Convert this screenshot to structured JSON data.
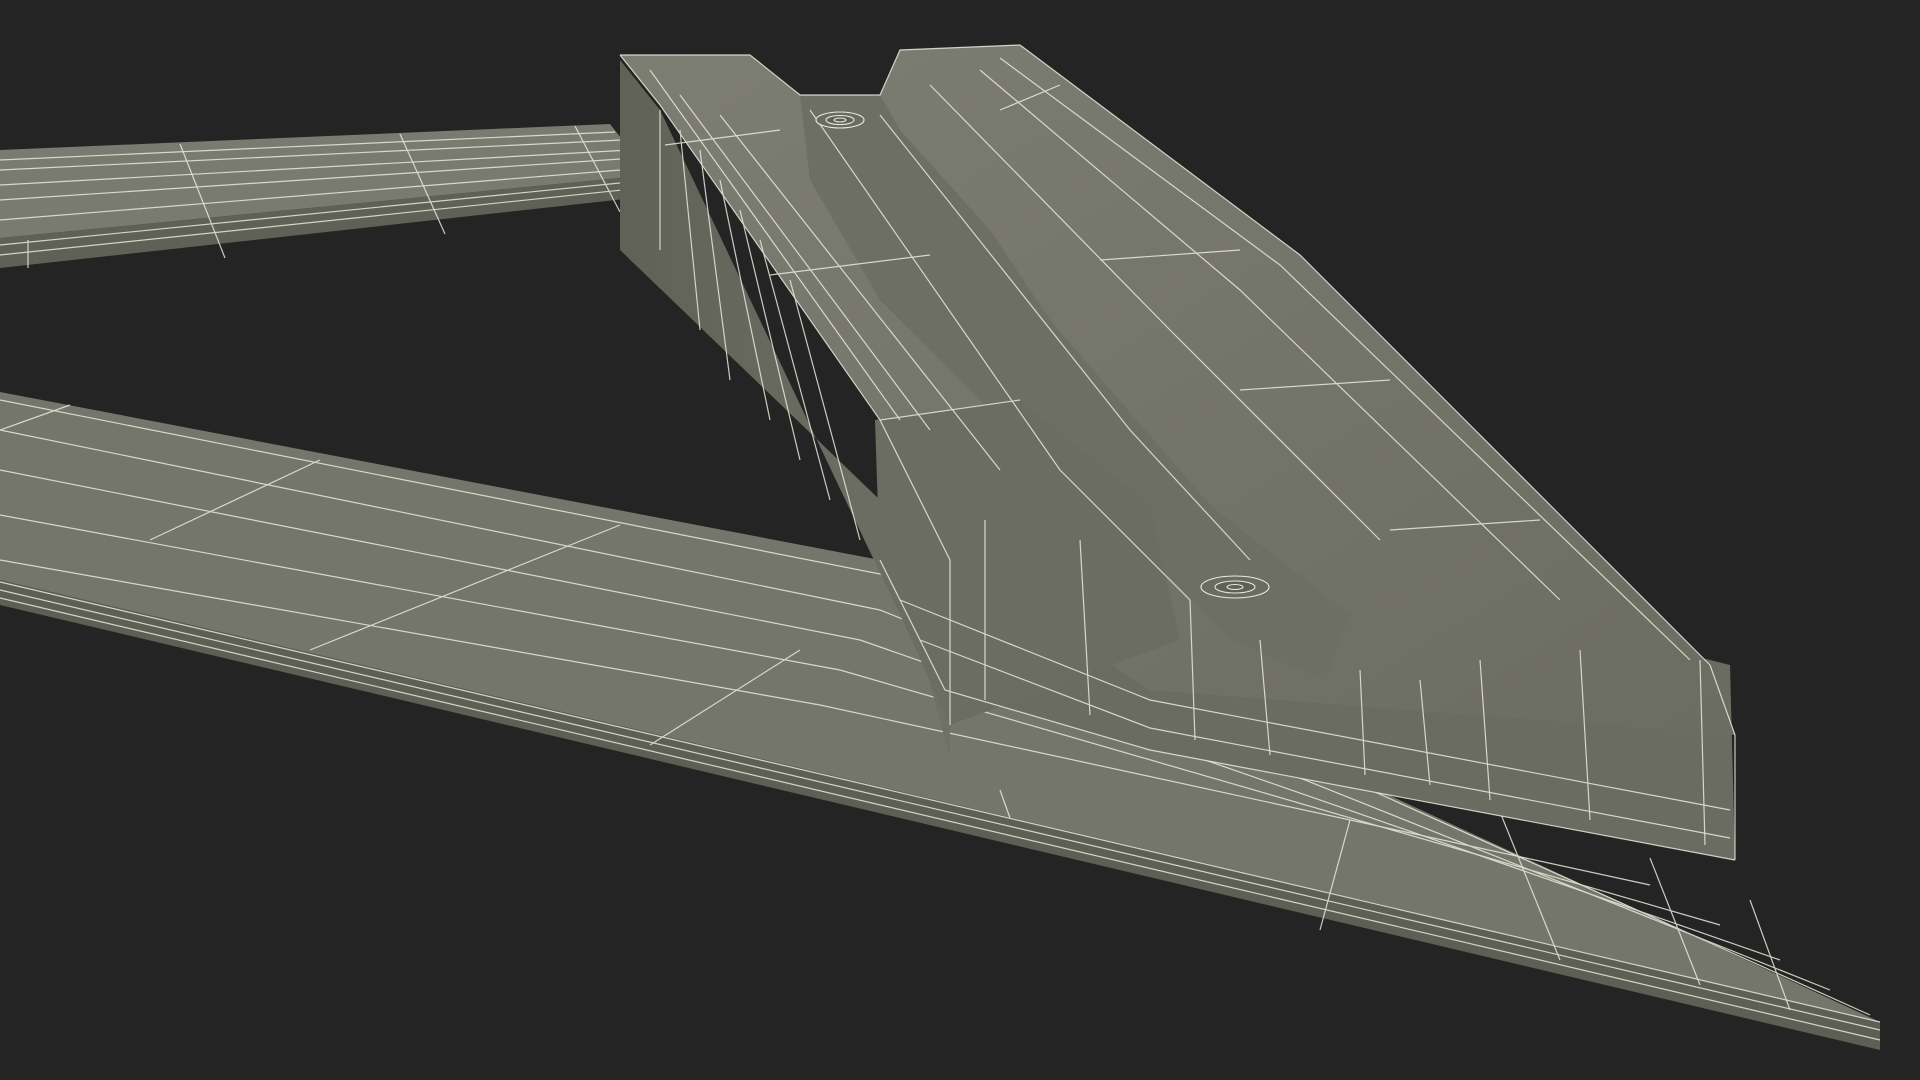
{
  "scene": {
    "subject": "wireframe-3d-model",
    "colors": {
      "background": "#242424",
      "surface_light": "#7b7c71",
      "surface_mid": "#6f7065",
      "surface_dark": "#5e5f55",
      "wire": "#e9e9dc"
    }
  }
}
